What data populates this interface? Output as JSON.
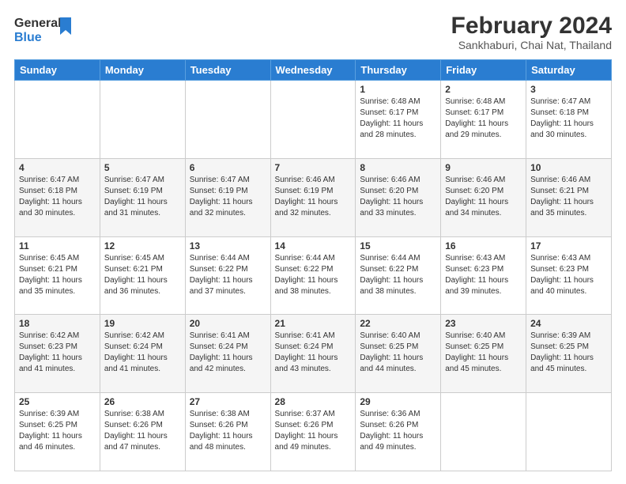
{
  "header": {
    "logo_line1": "General",
    "logo_line2": "Blue",
    "month_year": "February 2024",
    "location": "Sankhaburi, Chai Nat, Thailand"
  },
  "weekdays": [
    "Sunday",
    "Monday",
    "Tuesday",
    "Wednesday",
    "Thursday",
    "Friday",
    "Saturday"
  ],
  "weeks": [
    [
      {
        "day": "",
        "info": ""
      },
      {
        "day": "",
        "info": ""
      },
      {
        "day": "",
        "info": ""
      },
      {
        "day": "",
        "info": ""
      },
      {
        "day": "1",
        "info": "Sunrise: 6:48 AM\nSunset: 6:17 PM\nDaylight: 11 hours\nand 28 minutes."
      },
      {
        "day": "2",
        "info": "Sunrise: 6:48 AM\nSunset: 6:17 PM\nDaylight: 11 hours\nand 29 minutes."
      },
      {
        "day": "3",
        "info": "Sunrise: 6:47 AM\nSunset: 6:18 PM\nDaylight: 11 hours\nand 30 minutes."
      }
    ],
    [
      {
        "day": "4",
        "info": "Sunrise: 6:47 AM\nSunset: 6:18 PM\nDaylight: 11 hours\nand 30 minutes."
      },
      {
        "day": "5",
        "info": "Sunrise: 6:47 AM\nSunset: 6:19 PM\nDaylight: 11 hours\nand 31 minutes."
      },
      {
        "day": "6",
        "info": "Sunrise: 6:47 AM\nSunset: 6:19 PM\nDaylight: 11 hours\nand 32 minutes."
      },
      {
        "day": "7",
        "info": "Sunrise: 6:46 AM\nSunset: 6:19 PM\nDaylight: 11 hours\nand 32 minutes."
      },
      {
        "day": "8",
        "info": "Sunrise: 6:46 AM\nSunset: 6:20 PM\nDaylight: 11 hours\nand 33 minutes."
      },
      {
        "day": "9",
        "info": "Sunrise: 6:46 AM\nSunset: 6:20 PM\nDaylight: 11 hours\nand 34 minutes."
      },
      {
        "day": "10",
        "info": "Sunrise: 6:46 AM\nSunset: 6:21 PM\nDaylight: 11 hours\nand 35 minutes."
      }
    ],
    [
      {
        "day": "11",
        "info": "Sunrise: 6:45 AM\nSunset: 6:21 PM\nDaylight: 11 hours\nand 35 minutes."
      },
      {
        "day": "12",
        "info": "Sunrise: 6:45 AM\nSunset: 6:21 PM\nDaylight: 11 hours\nand 36 minutes."
      },
      {
        "day": "13",
        "info": "Sunrise: 6:44 AM\nSunset: 6:22 PM\nDaylight: 11 hours\nand 37 minutes."
      },
      {
        "day": "14",
        "info": "Sunrise: 6:44 AM\nSunset: 6:22 PM\nDaylight: 11 hours\nand 38 minutes."
      },
      {
        "day": "15",
        "info": "Sunrise: 6:44 AM\nSunset: 6:22 PM\nDaylight: 11 hours\nand 38 minutes."
      },
      {
        "day": "16",
        "info": "Sunrise: 6:43 AM\nSunset: 6:23 PM\nDaylight: 11 hours\nand 39 minutes."
      },
      {
        "day": "17",
        "info": "Sunrise: 6:43 AM\nSunset: 6:23 PM\nDaylight: 11 hours\nand 40 minutes."
      }
    ],
    [
      {
        "day": "18",
        "info": "Sunrise: 6:42 AM\nSunset: 6:23 PM\nDaylight: 11 hours\nand 41 minutes."
      },
      {
        "day": "19",
        "info": "Sunrise: 6:42 AM\nSunset: 6:24 PM\nDaylight: 11 hours\nand 41 minutes."
      },
      {
        "day": "20",
        "info": "Sunrise: 6:41 AM\nSunset: 6:24 PM\nDaylight: 11 hours\nand 42 minutes."
      },
      {
        "day": "21",
        "info": "Sunrise: 6:41 AM\nSunset: 6:24 PM\nDaylight: 11 hours\nand 43 minutes."
      },
      {
        "day": "22",
        "info": "Sunrise: 6:40 AM\nSunset: 6:25 PM\nDaylight: 11 hours\nand 44 minutes."
      },
      {
        "day": "23",
        "info": "Sunrise: 6:40 AM\nSunset: 6:25 PM\nDaylight: 11 hours\nand 45 minutes."
      },
      {
        "day": "24",
        "info": "Sunrise: 6:39 AM\nSunset: 6:25 PM\nDaylight: 11 hours\nand 45 minutes."
      }
    ],
    [
      {
        "day": "25",
        "info": "Sunrise: 6:39 AM\nSunset: 6:25 PM\nDaylight: 11 hours\nand 46 minutes."
      },
      {
        "day": "26",
        "info": "Sunrise: 6:38 AM\nSunset: 6:26 PM\nDaylight: 11 hours\nand 47 minutes."
      },
      {
        "day": "27",
        "info": "Sunrise: 6:38 AM\nSunset: 6:26 PM\nDaylight: 11 hours\nand 48 minutes."
      },
      {
        "day": "28",
        "info": "Sunrise: 6:37 AM\nSunset: 6:26 PM\nDaylight: 11 hours\nand 49 minutes."
      },
      {
        "day": "29",
        "info": "Sunrise: 6:36 AM\nSunset: 6:26 PM\nDaylight: 11 hours\nand 49 minutes."
      },
      {
        "day": "",
        "info": ""
      },
      {
        "day": "",
        "info": ""
      }
    ]
  ]
}
